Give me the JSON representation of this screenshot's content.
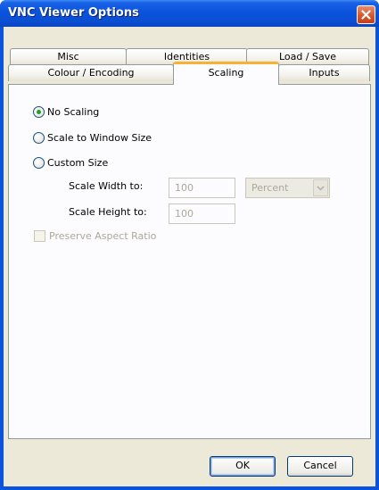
{
  "window": {
    "title": "VNC Viewer Options"
  },
  "tabs": {
    "row1": [
      {
        "label": "Misc"
      },
      {
        "label": "Identities"
      },
      {
        "label": "Load / Save"
      }
    ],
    "row2": [
      {
        "label": "Colour / Encoding"
      },
      {
        "label": "Scaling",
        "active": true
      },
      {
        "label": "Inputs"
      }
    ]
  },
  "scaling": {
    "options": [
      {
        "label": "No Scaling",
        "checked": true
      },
      {
        "label": "Scale to Window Size",
        "checked": false
      },
      {
        "label": "Custom Size",
        "checked": false
      }
    ],
    "width_label": "Scale Width to:",
    "width_value": "100",
    "unit_value": "Percent",
    "height_label": "Scale Height to:",
    "height_value": "100",
    "preserve_label": "Preserve Aspect Ratio",
    "preserve_checked": false
  },
  "buttons": {
    "ok": "OK",
    "cancel": "Cancel"
  },
  "colors": {
    "titlebar": "#0a53dc",
    "dialog_bg": "#ece9d8",
    "active_tab_accent": "#f8b133"
  },
  "icons": {
    "close": "close-icon",
    "dropdown": "chevron-down-icon"
  }
}
